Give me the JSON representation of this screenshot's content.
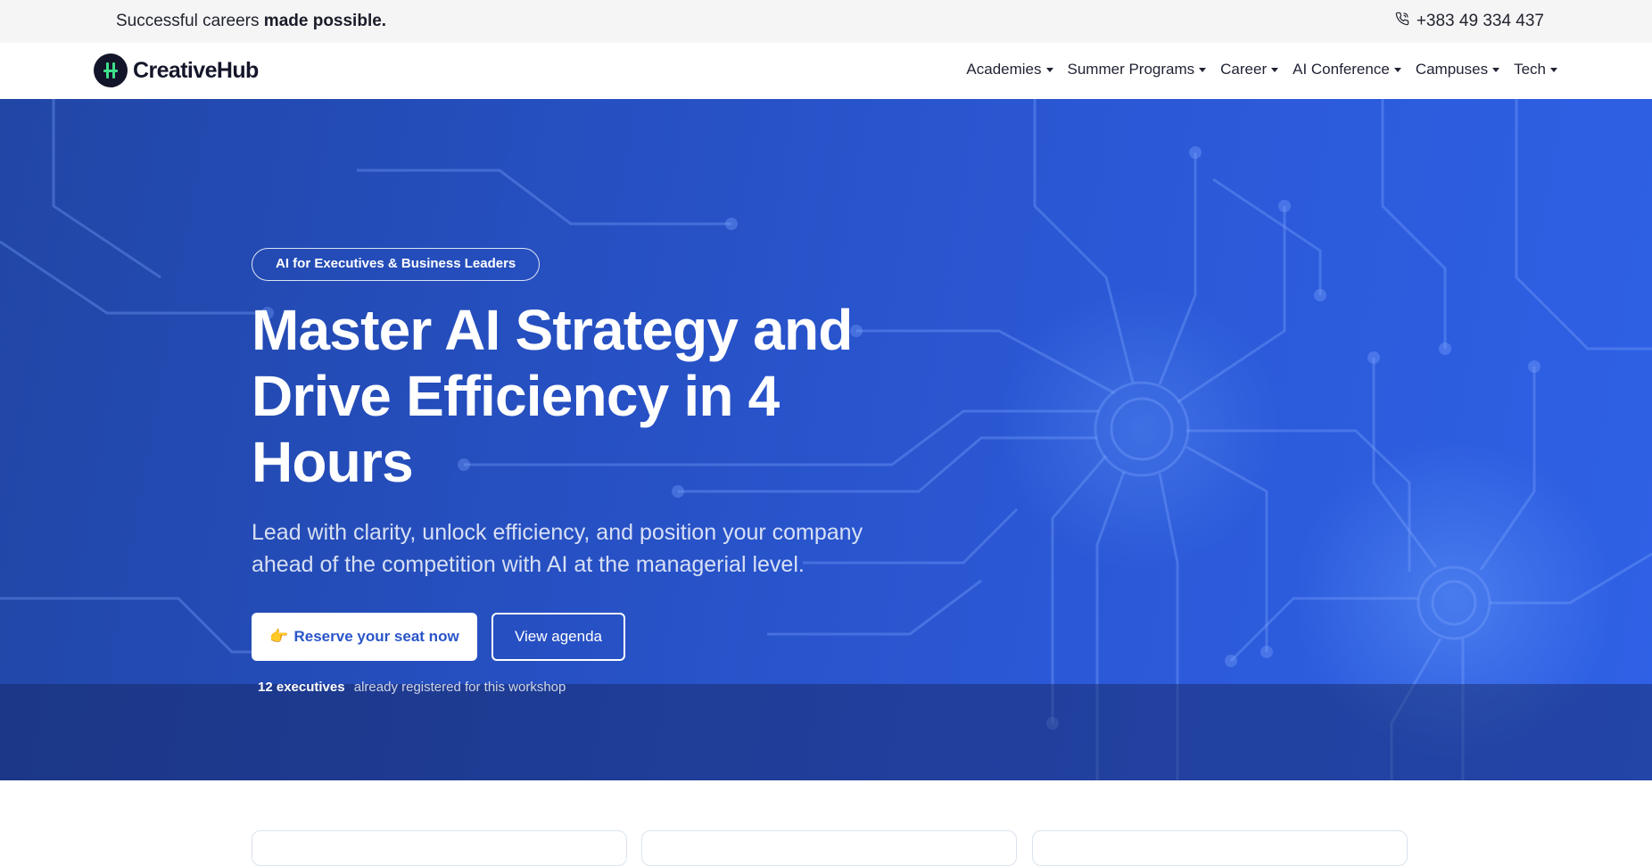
{
  "topbar": {
    "tagline_regular": "Successful careers ",
    "tagline_bold": "made possible.",
    "phone": "+383 49 334 437"
  },
  "navbar": {
    "logo_text": "CreativeHub",
    "items": [
      "Academies",
      "Summer Programs",
      "Career",
      "AI Conference",
      "Campuses",
      "Tech"
    ]
  },
  "hero": {
    "badge": "AI for Executives & Business Leaders",
    "headline": "Master AI Strategy and Drive Efficiency in 4 Hours",
    "subheadline": "Lead with clarity, unlock efficiency, and position your company ahead of the competition with AI at the managerial level.",
    "primary_button_emoji": "👉",
    "primary_button": "Reserve your seat now",
    "secondary_button": "View agenda",
    "registered_count": "12 executives",
    "registered_text": "already registered for this workshop"
  },
  "colors": {
    "hero_blue": "#2a55c9",
    "logo_green": "#3ee08a",
    "dark": "#13152a"
  },
  "icons": [
    "phone-icon",
    "logo-mark-icon",
    "chevron-down-icon",
    "pointing-hand-icon"
  ]
}
